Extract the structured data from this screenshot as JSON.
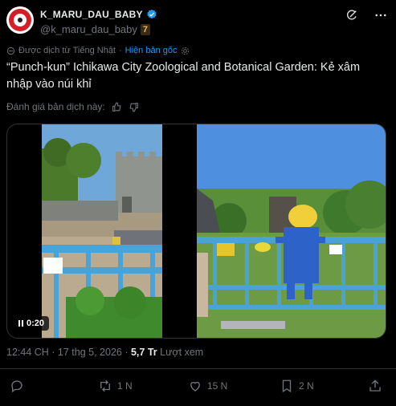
{
  "author": {
    "display_name": "K_MARU_DAU_BABY",
    "handle": "@k_maru_dau_baby",
    "badge": "7"
  },
  "translation": {
    "notice": "Được dịch từ Tiếng Nhật",
    "show_original": "Hiện bản gốc"
  },
  "tweet": {
    "text": "“Punch-kun” Ichikawa City Zoological and Botanical Garden: Kẻ xâm nhập vào núi khỉ"
  },
  "rating": {
    "label": "Đánh giá bản dịch này:"
  },
  "media": {
    "timestamp": "0:20"
  },
  "meta": {
    "time": "12:44 CH · 17 thg 5, 2026 · ",
    "views_count": "5,7 Tr",
    "views_label": " Lượt xem"
  },
  "actions": {
    "replies": "",
    "retweets": "1 N",
    "likes": "15 N",
    "bookmarks": "2 N"
  },
  "colors": {
    "background": "#000000",
    "accent": "#1d9bf0",
    "muted": "#71767b",
    "text": "#e7e9ea"
  },
  "icons": [
    "avatar-logo",
    "verified-icon",
    "grok-icon",
    "more-icon",
    "translate-icon",
    "settings-icon",
    "thumbs-up-icon",
    "thumbs-down-icon",
    "pause-icon",
    "reply-icon",
    "retweet-icon",
    "like-icon",
    "bookmark-icon",
    "share-icon"
  ]
}
